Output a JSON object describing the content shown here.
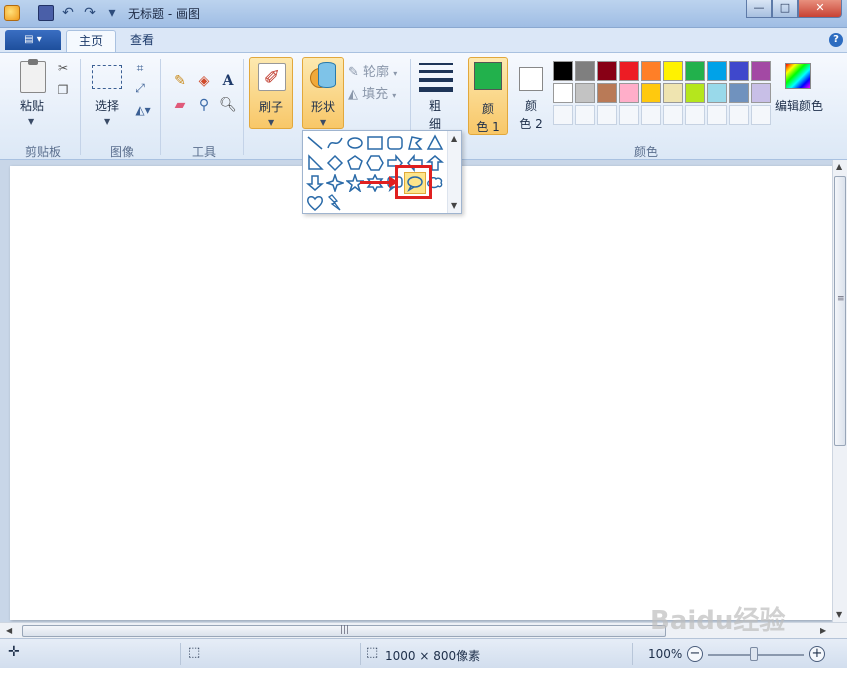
{
  "window": {
    "title": "无标题 - 画图"
  },
  "title_buttons": {
    "minimize": "—",
    "maximize": "□",
    "close": "✕"
  },
  "tabs": {
    "home": "主页",
    "view": "查看"
  },
  "help": "?",
  "ribbon": {
    "clipboard": {
      "paste": "粘贴",
      "group": "剪贴板"
    },
    "image": {
      "select": "选择",
      "group": "图像"
    },
    "tools": {
      "group": "工具"
    },
    "brushes": "刷子",
    "shapes": {
      "label": "形状",
      "outline": "轮廓",
      "fill": "填充"
    },
    "size": {
      "line1": "粗",
      "line2": "细"
    },
    "color1": {
      "line1": "颜",
      "line2": "色 1",
      "color": "#22b14c"
    },
    "color2": {
      "line1": "颜",
      "line2": "色 2",
      "color": "#ffffff"
    },
    "edit_colors": "编辑颜色",
    "colors_group": "颜色",
    "palette": [
      "#000000",
      "#7f7f7f",
      "#880015",
      "#ed1c24",
      "#ff7f27",
      "#fff200",
      "#22b14c",
      "#00a2e8",
      "#3f48cc",
      "#a349a4",
      "#ffffff",
      "#c3c3c3",
      "#b97a57",
      "#ffaec9",
      "#ffc90e",
      "#efe4b0",
      "#b5e61d",
      "#99d9ea",
      "#7092be",
      "#c8bfe7"
    ],
    "empty_slots": 10
  },
  "status": {
    "dimensions": "1000 × 800像素",
    "zoom": "100%"
  },
  "watermark": "Baidu经验"
}
